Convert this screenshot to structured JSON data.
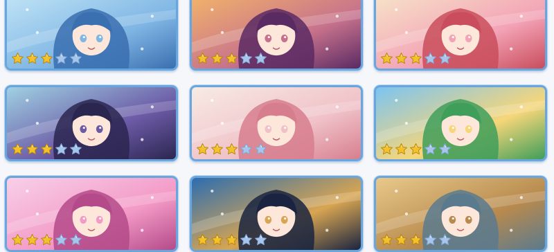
{
  "colors": {
    "frame": "#6aa6de",
    "star_filled": "#f3c22b",
    "star_empty": "#a8c6ea"
  },
  "cards": [
    {
      "id": "card-1",
      "character": "light-blue-hair-ice-character",
      "stars_filled": 3,
      "stars_total": 5,
      "palette": [
        "#bfe3f6",
        "#7fb6e4",
        "#3a6fb0"
      ]
    },
    {
      "id": "card-2",
      "character": "purple-hair-glasses-sunset-character",
      "stars_filled": 3,
      "stars_total": 5,
      "palette": [
        "#f2b36a",
        "#c7728c",
        "#5a2a63"
      ]
    },
    {
      "id": "card-3",
      "character": "blonde-pink-costume-character",
      "stars_filled": 3,
      "stars_total": 5,
      "palette": [
        "#f7e2c8",
        "#f3a3b6",
        "#c94d5c"
      ]
    },
    {
      "id": "card-4",
      "character": "purple-hair-cat-ear-character",
      "stars_filled": 3,
      "stars_total": 5,
      "palette": [
        "#9fd1e3",
        "#6c5aa6",
        "#2b2650"
      ]
    },
    {
      "id": "card-5",
      "character": "pink-hair-bunny-character",
      "stars_filled": 3,
      "stars_total": 5,
      "palette": [
        "#f7ebe4",
        "#f0c2c8",
        "#d77e8e"
      ]
    },
    {
      "id": "card-6",
      "character": "blonde-green-fruit-character",
      "stars_filled": 3,
      "stars_total": 5,
      "palette": [
        "#7cc4f2",
        "#f6d679",
        "#3f9e5a"
      ]
    },
    {
      "id": "card-7",
      "character": "pink-hair-candy-character",
      "stars_filled": 3,
      "stars_total": 5,
      "palette": [
        "#f8d0e8",
        "#f39ac6",
        "#b44a8a"
      ]
    },
    {
      "id": "card-8",
      "character": "blonde-dark-wings-character",
      "stars_filled": 3,
      "stars_total": 5,
      "palette": [
        "#2c6db0",
        "#d8a552",
        "#1a2440"
      ]
    },
    {
      "id": "card-9",
      "character": "green-hair-goggles-character",
      "stars_filled": 3,
      "stars_total": 5,
      "palette": [
        "#e8c98a",
        "#b88a4e",
        "#5a7a8e"
      ]
    }
  ]
}
